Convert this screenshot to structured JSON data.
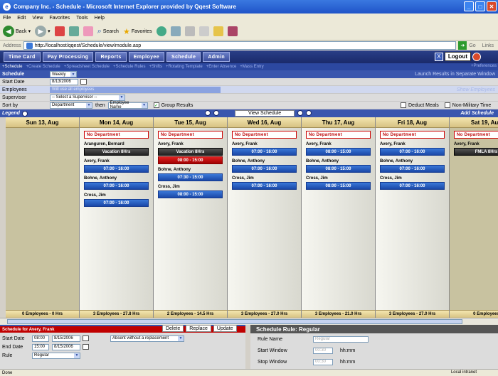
{
  "window": {
    "title": "Company Inc. - Schedule - Microsoft Internet Explorer provided by Qqest Software"
  },
  "menu": [
    "File",
    "Edit",
    "View",
    "Favorites",
    "Tools",
    "Help"
  ],
  "toolbar": {
    "back": "Back",
    "search": "Search",
    "favorites": "Favorites"
  },
  "address": {
    "label": "Address",
    "url": "http://localhost/qqest/Schedule/view/module.asp",
    "go": "Go",
    "links": "Links"
  },
  "tabs": [
    "Time Card",
    "Pay Processing",
    "Reports",
    "Employee",
    "Schedule",
    "Admin"
  ],
  "logout": "Logout",
  "subnav": [
    "+Schedule",
    "+Create Schedule",
    "+Spreadsheet Schedule",
    "+Schedule Rules",
    "+Shifts",
    "+Rotating Template",
    "+Enter Absence",
    "+Mass Entry"
  ],
  "preferences": "+Preferences",
  "form": {
    "header": "Schedule",
    "period": "Weekly",
    "launch": "Launch Results in Separate Window",
    "start_label": "Start Date",
    "start_value": "8/13/2006",
    "employees_label": "Employees",
    "employees_value": "Will use all employees",
    "show_employees": "Show Employees",
    "supervisor_label": "Supervisor",
    "supervisor_value": "-- Select a Supervisor --",
    "sort_label": "Sort by",
    "sort_value": "Department",
    "then_label": "then",
    "then_value": "Employee Name",
    "group_results": "Group Results",
    "deduct_meals": "Deduct Meals",
    "non_military": "Non-Military Time"
  },
  "legend": "Legend",
  "view_schedule": "View Schedule",
  "add_schedule": "Add Schedule",
  "days": [
    {
      "header": "Sun 13, Aug",
      "footer": "0 Employees - 0 Hrs",
      "cells": []
    },
    {
      "header": "Mon 14, Aug",
      "footer": "3 Employees - 27.8 Hrs",
      "cells": [
        {
          "t": "dept",
          "v": "No Department"
        },
        {
          "t": "emp",
          "v": "Aranguren, Bernard"
        },
        {
          "t": "shift",
          "c": "dark",
          "v": "Vacation 8Hrs"
        },
        {
          "t": "emp",
          "v": "Avery, Frank"
        },
        {
          "t": "shift",
          "v": "07:00 - 16:00"
        },
        {
          "t": "emp",
          "v": "Bohne, Anthony"
        },
        {
          "t": "shift",
          "v": "07:00 - 16:00"
        },
        {
          "t": "emp",
          "v": "Cross, Jim"
        },
        {
          "t": "shift",
          "v": "07:00 - 16:00"
        }
      ]
    },
    {
      "header": "Tue 15, Aug",
      "footer": "2 Employees - 14.5 Hrs",
      "cells": [
        {
          "t": "dept",
          "v": "No Department"
        },
        {
          "t": "emp",
          "v": "Avery, Frank"
        },
        {
          "t": "shift",
          "c": "dark",
          "v": "Vacation 8Hrs"
        },
        {
          "t": "shift",
          "c": "red",
          "v": "08:00 - 15:00"
        },
        {
          "t": "emp",
          "v": "Bohne, Anthony"
        },
        {
          "t": "shift",
          "v": "07:30 - 15:00"
        },
        {
          "t": "emp",
          "v": "Cross, Jim"
        },
        {
          "t": "shift",
          "v": "08:00 - 15:00"
        }
      ]
    },
    {
      "header": "Wed 16, Aug",
      "footer": "3 Employees - 27.0 Hrs",
      "cells": [
        {
          "t": "dept",
          "v": "No Department"
        },
        {
          "t": "emp",
          "v": "Avery, Frank"
        },
        {
          "t": "shift",
          "v": "07:00 - 16:00"
        },
        {
          "t": "emp",
          "v": "Bohne, Anthony"
        },
        {
          "t": "shift",
          "v": "07:00 - 16:00"
        },
        {
          "t": "emp",
          "v": "Cross, Jim"
        },
        {
          "t": "shift",
          "v": "07:00 - 16:00"
        }
      ]
    },
    {
      "header": "Thu 17, Aug",
      "footer": "3 Employees - 21.0 Hrs",
      "cells": [
        {
          "t": "dept",
          "v": "No Department"
        },
        {
          "t": "emp",
          "v": "Avery, Frank"
        },
        {
          "t": "shift",
          "v": "08:00 - 15:00"
        },
        {
          "t": "emp",
          "v": "Bohne, Anthony"
        },
        {
          "t": "shift",
          "v": "08:00 - 15:00"
        },
        {
          "t": "emp",
          "v": "Cross, Jim"
        },
        {
          "t": "shift",
          "v": "08:00 - 15:00"
        }
      ]
    },
    {
      "header": "Fri 18, Aug",
      "footer": "3 Employees - 27.0 Hrs",
      "cells": [
        {
          "t": "dept",
          "v": "No Department"
        },
        {
          "t": "emp",
          "v": "Avery, Frank"
        },
        {
          "t": "shift",
          "v": "07:00 - 16:00"
        },
        {
          "t": "emp",
          "v": "Bohne, Anthony"
        },
        {
          "t": "shift",
          "v": "07:00 - 16:00"
        },
        {
          "t": "emp",
          "v": "Cross, Jim"
        },
        {
          "t": "shift",
          "v": "07:00 - 16:00"
        }
      ]
    },
    {
      "header": "Sat 19, Aug",
      "footer": "0 Employees",
      "cells": [
        {
          "t": "dept",
          "v": "No Department"
        },
        {
          "t": "emp",
          "v": "Avery, Frank"
        },
        {
          "t": "shift",
          "c": "dark",
          "v": "FMLA 8Hrs"
        }
      ]
    }
  ],
  "detail": {
    "header": "Schedule for Avery, Frank",
    "delete": "Delete",
    "replace": "Replace",
    "update": "Update",
    "start_label": "Start Date",
    "start_time": "08:00",
    "start_date": "8/15/2006",
    "end_label": "End Date",
    "end_time": "15:00",
    "end_date": "8/15/2006",
    "rule_label": "Rule",
    "rule_value": "Regular",
    "absence": "Absent without a replacement"
  },
  "rule": {
    "header": "Schedule Rule: Regular",
    "name_label": "Rule Name",
    "name_value": "Regular",
    "start_label": "Start Window",
    "start_value": "00:30",
    "start_unit": "hh:mm",
    "stop_label": "Stop Window",
    "stop_value": "00:30",
    "stop_unit": "hh:mm"
  },
  "status": {
    "left": "Done",
    "zone": "Local intranet"
  }
}
